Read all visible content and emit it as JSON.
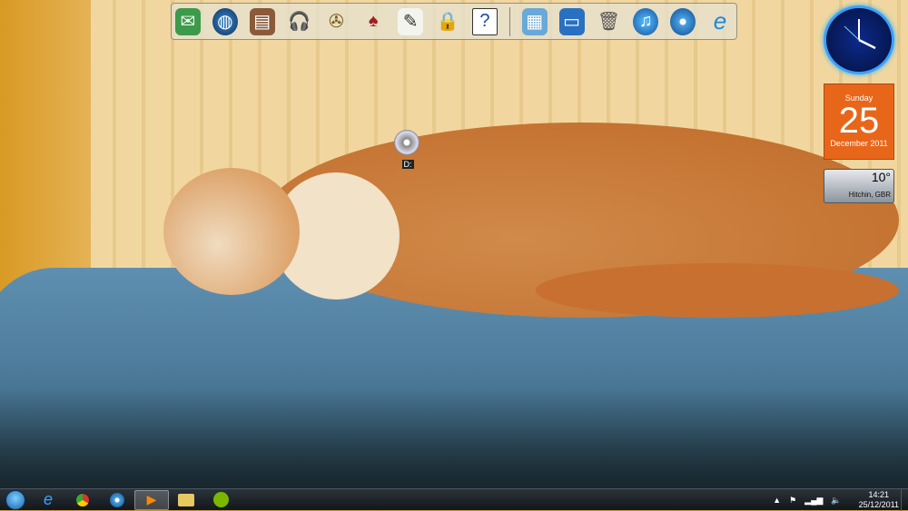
{
  "dock": {
    "icons": [
      "mail-icon",
      "globe-icon",
      "books-icon",
      "headphones-icon",
      "film-reel-icon",
      "games-cards-icon",
      "notepad-icon",
      "padlock-icon",
      "help-icon",
      "control-panel-icon",
      "computer-icon",
      "recycle-bin-icon",
      "itunes-icon",
      "safari-icon",
      "internet-explorer-icon"
    ]
  },
  "desktop": {
    "drive_label": "D:"
  },
  "gadgets": {
    "calendar": {
      "weekday": "Sunday",
      "day": "25",
      "month_year": "December 2011"
    },
    "weather": {
      "temp": "10°",
      "city": "Hitchin, GBR"
    }
  },
  "taskbar": {
    "apps": [
      "internet-explorer",
      "chrome",
      "safari",
      "media-player",
      "windows-explorer",
      "spotify"
    ],
    "active": "media-player"
  },
  "tray": {
    "time": "14:21",
    "date": "25/12/2011"
  }
}
